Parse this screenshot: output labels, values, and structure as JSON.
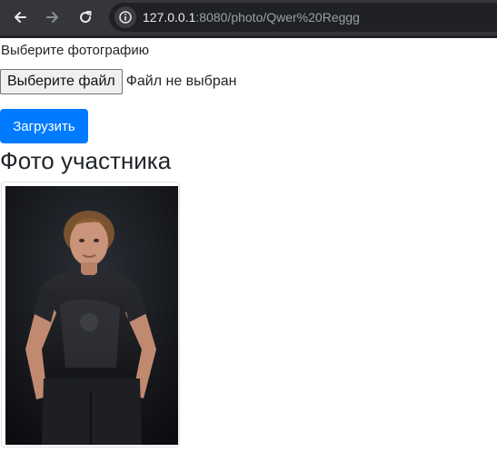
{
  "browser": {
    "back_icon": "arrow-left-icon",
    "forward_icon": "arrow-right-icon",
    "reload_icon": "reload-icon",
    "site_info_icon": "info-icon",
    "url_host": "127.0.0.1",
    "url_rest": ":8080/photo/Qwer%20Reggg"
  },
  "upload_form": {
    "label": "Выберите фотографию",
    "file_button_label": "Выберите файл",
    "file_status": "Файл не выбран",
    "submit_label": "Загрузить",
    "submit_color": "#007bff"
  },
  "photo_section": {
    "heading": "Фото участника"
  }
}
